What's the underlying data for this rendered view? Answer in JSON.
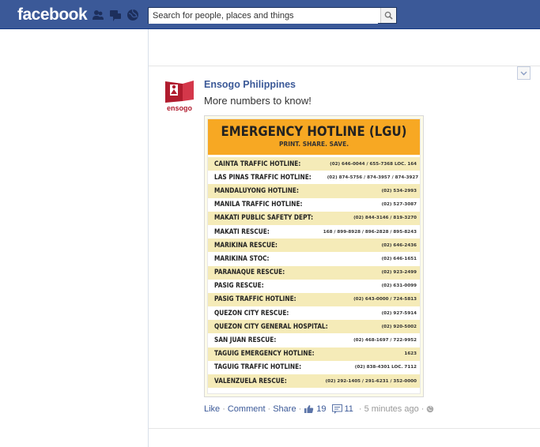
{
  "topbar": {
    "logo": "facebook",
    "search_placeholder": "Search for people, places and things",
    "jewels": [
      "friend-requests-icon",
      "messages-icon",
      "notifications-icon"
    ]
  },
  "post": {
    "author": "Ensogo Philippines",
    "avatar_text": "ensogo",
    "message": "More numbers to know!",
    "image": {
      "title": "EMERGENCY HOTLINE (LGU)",
      "subtitle": "PRINT. SHARE. SAVE.",
      "rows": [
        {
          "label": "CAINTA TRAFFIC HOTLINE:",
          "number": "(02) 646-0044  /  655-7368 LOC. 164"
        },
        {
          "label": "LAS PINAS TRAFFIC HOTLINE:",
          "number": "(02) 874-5756  /  874-3957  /  874-3927"
        },
        {
          "label": "MANDALUYONG HOTLINE:",
          "number": "(02) 534-2993"
        },
        {
          "label": "MANILA TRAFFIC HOTLINE:",
          "number": "(02) 527-3087"
        },
        {
          "label": "MAKATI PUBLIC SAFETY DEPT:",
          "number": "(02) 844-3146  /  819-3270"
        },
        {
          "label": "MAKATI RESCUE:",
          "number": "168 / 899-8928 / 896-2828 / 895-8243"
        },
        {
          "label": "MARIKINA RESCUE:",
          "number": "(02) 646-2436"
        },
        {
          "label": "MARIKINA STOC:",
          "number": "(02) 646-1651"
        },
        {
          "label": "PARANAQUE RESCUE:",
          "number": "(02) 923-2499"
        },
        {
          "label": "PASIG RESCUE:",
          "number": "(02) 631-0099"
        },
        {
          "label": "PASIG TRAFFIC HOTLINE:",
          "number": "(02) 643-0000  /  724-5813"
        },
        {
          "label": "QUEZON CITY RESCUE:",
          "number": "(02) 927-5914"
        },
        {
          "label": "QUEZON CITY GENERAL HOSPITAL:",
          "number": "(02) 920-5002"
        },
        {
          "label": "SAN JUAN RESCUE:",
          "number": "(02) 468-1697 / 722-9952"
        },
        {
          "label": "TAGUIG EMERGENCY HOTLINE:",
          "number": "1623"
        },
        {
          "label": "TAGUIG TRAFFIC HOTLINE:",
          "number": "(02) 838-4301 LOC. 7112"
        },
        {
          "label": "VALENZUELA RESCUE:",
          "number": "(02) 292-1405  /  291-6231  /  352-0000"
        }
      ]
    },
    "actions": {
      "like": "Like",
      "comment": "Comment",
      "share": "Share",
      "likes_count": "19",
      "comments_count": "11",
      "time": "5 minutes ago",
      "separator": "·"
    }
  },
  "colors": {
    "brand": "#3b5998",
    "banner": "#f7a823",
    "row_alt": "#f5ebb8"
  }
}
